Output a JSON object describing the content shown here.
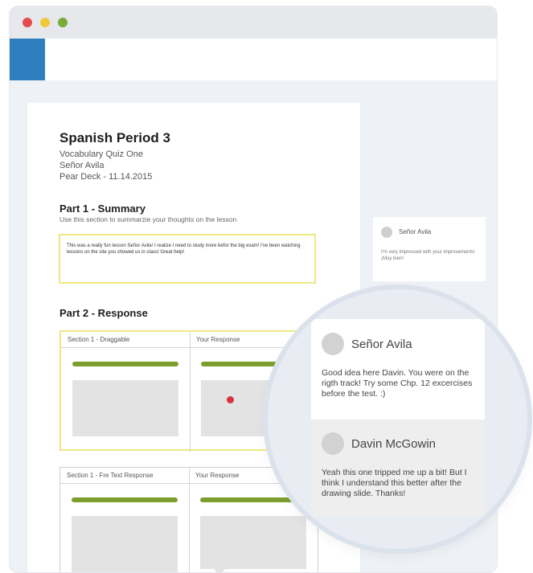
{
  "window": {
    "controls": [
      {
        "name": "close",
        "color": "#e24c4c"
      },
      {
        "name": "minimize",
        "color": "#f0c93a"
      },
      {
        "name": "maximize",
        "color": "#7aaa3c"
      }
    ]
  },
  "colors": {
    "brand_blue": "#2f7ec0",
    "highlight_yellow": "#efe882",
    "progress_green": "#7c9e2f",
    "marker_red": "#d9323a"
  },
  "document": {
    "title": "Spanish Period 3",
    "meta": [
      "Vocabulary Quiz One",
      "Señor Avila",
      "Pear Deck - 11.14.2015"
    ],
    "part1": {
      "heading": "Part 1 - Summary",
      "instructions": "Use this section to summarzie your thoughts on the lesson",
      "response": "This was a really fun lesson Señor Avila! I realize I need to study more befor the big exam! I've been watching lessons on the site you showed us in class! Great help!"
    },
    "part2": {
      "heading": "Part 2 - Response",
      "table1": {
        "col1": "Section 1 - Draggable",
        "col2": "Your Response"
      },
      "table2": {
        "col1": "Section 1 - Fre Text Response",
        "col2": "Your Response"
      }
    }
  },
  "side_comment": {
    "author": "Señor Avila",
    "text": "I'm very impressed with your improvements! ¡Muy bien!"
  },
  "magnified_comments": [
    {
      "author": "Señor Avila",
      "text": "Good idea here Davin. You were on the rigth track! Try some Chp. 12 excercises before the test. :)"
    },
    {
      "author": "Davin McGowin",
      "text": "Yeah this one tripped me up a bit! But I think I understand this better after the drawing slide. Thanks!"
    }
  ]
}
